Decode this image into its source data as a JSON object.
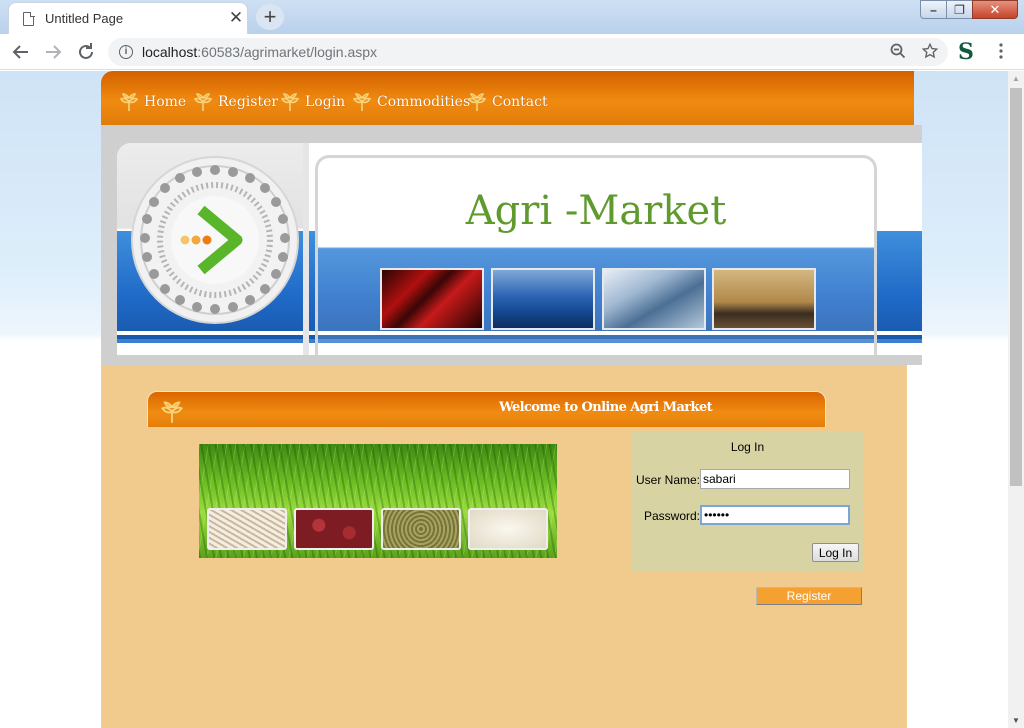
{
  "browser": {
    "tab_title": "Untitled Page",
    "tab_close": "✕",
    "new_tab": "+",
    "url_host": "localhost",
    "url_rest": ":60583/agrimarket/login.aspx",
    "window_buttons": {
      "minimize": "–",
      "restore": "❐",
      "close": "✕"
    }
  },
  "site": {
    "nav": [
      "Home",
      "Register",
      "Login",
      "Commodities",
      "Contact"
    ],
    "title": "Agri -Market",
    "welcome": "Welcome to Online Agri Market",
    "colors": {
      "nav_orange": "#f08a10",
      "content_bg": "#f0cb8d",
      "title_green": "#5f9a2f",
      "login_bg": "#d8d3a3"
    }
  },
  "login": {
    "title": "Log In",
    "username_label": "User Name:",
    "username_value": "sabari",
    "password_label": "Password:",
    "password_value": "••••••",
    "login_button": "Log In"
  },
  "register_button": "Register"
}
